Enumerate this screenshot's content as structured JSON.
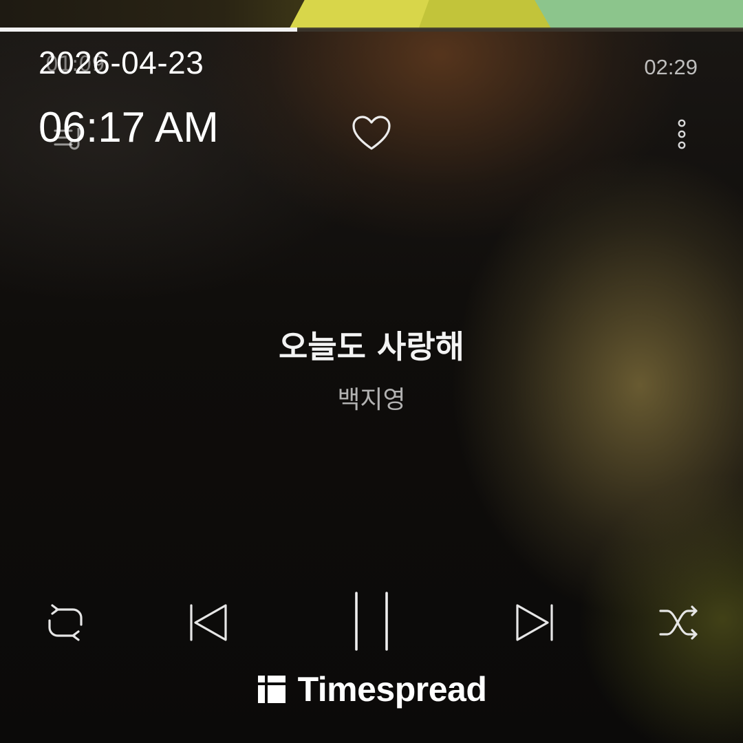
{
  "player": {
    "current_time_ghost": "01:09",
    "total_time": "02:29",
    "progress_fraction": 0.4
  },
  "overlay": {
    "date": "2026-04-23",
    "time": "06:17 AM"
  },
  "track": {
    "title": "오늘도 사랑해",
    "artist": "백지영"
  },
  "controls": {
    "repeat_icon": "repeat-icon",
    "prev_icon": "skip-previous-icon",
    "play_state_icon": "pause-icon",
    "next_icon": "skip-next-icon",
    "shuffle_icon": "shuffle-icon",
    "lyrics_icon": "lyrics-icon",
    "favorite_icon": "heart-icon",
    "more_icon": "more-vertical-icon"
  },
  "watermark": {
    "brand": "Timespread"
  },
  "colors": {
    "progress_fill": "#f2f2f2",
    "text_primary": "#ffffff",
    "accent_glow": "#786838"
  }
}
